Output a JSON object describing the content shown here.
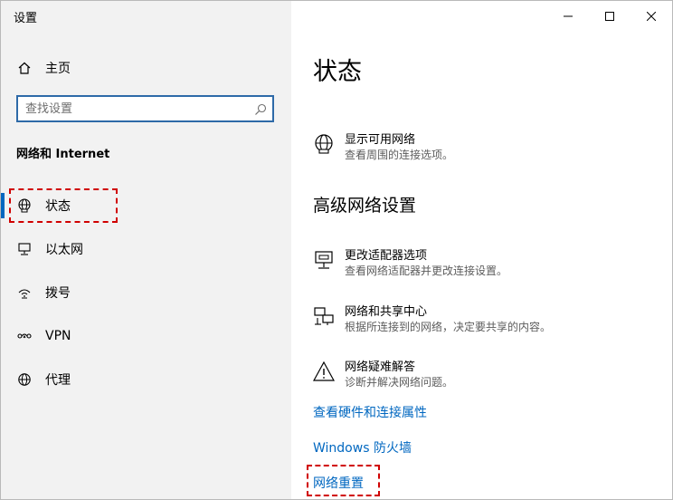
{
  "window": {
    "title": "设置"
  },
  "sidebar": {
    "home_label": "主页",
    "search_placeholder": "查找设置",
    "section_title": "网络和 Internet",
    "items": [
      {
        "label": "状态",
        "icon": "globe-icon",
        "active": true
      },
      {
        "label": "以太网",
        "icon": "ethernet-icon"
      },
      {
        "label": "拨号",
        "icon": "dialup-icon"
      },
      {
        "label": "VPN",
        "icon": "vpn-icon"
      },
      {
        "label": "代理",
        "icon": "globe-icon"
      }
    ]
  },
  "main": {
    "title": "状态",
    "show_networks": {
      "title": "显示可用网络",
      "desc": "查看周围的连接选项。"
    },
    "advanced_title": "高级网络设置",
    "advanced_items": [
      {
        "title": "更改适配器选项",
        "desc": "查看网络适配器并更改连接设置。",
        "icon": "adapter-icon"
      },
      {
        "title": "网络和共享中心",
        "desc": "根据所连接到的网络，决定要共享的内容。",
        "icon": "sharing-center-icon"
      },
      {
        "title": "网络疑难解答",
        "desc": "诊断并解决网络问题。",
        "icon": "warning-icon"
      }
    ],
    "links": [
      "查看硬件和连接属性",
      "Windows 防火墙",
      "网络重置"
    ]
  },
  "colors": {
    "accent": "#0067c0",
    "annotation": "#d00000",
    "sidebar_bg": "#f2f2f2"
  }
}
